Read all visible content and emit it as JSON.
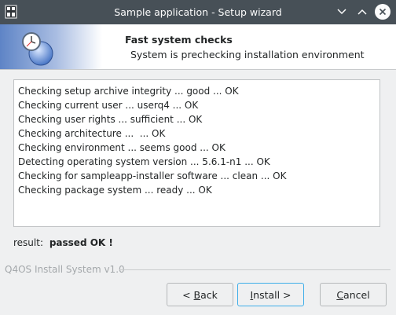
{
  "window": {
    "title": "Sample application - Setup wizard"
  },
  "header": {
    "title": "Fast system checks",
    "subtitle": "System is prechecking installation environment"
  },
  "log": {
    "lines": [
      "Checking setup archive integrity ... good ... OK",
      "Checking current user ... userq4 ... OK",
      "Checking user rights ... sufficient ... OK",
      "Checking architecture ...  ... OK",
      "Checking environment ... seems good ... OK",
      "Detecting operating system version ... 5.6.1-n1 ... OK",
      "Checking for sampleapp-installer software ... clean ... OK",
      "Checking package system ... ready ... OK"
    ]
  },
  "result": {
    "label": "result:",
    "value": "passed OK !"
  },
  "footer": {
    "label": "Q4OS Install System v1.0"
  },
  "buttons": {
    "back_prefix": "< ",
    "back_key": "B",
    "back_rest": "ack",
    "install_key": "I",
    "install_rest": "nstall >",
    "cancel_key": "C",
    "cancel_rest": "ancel"
  }
}
